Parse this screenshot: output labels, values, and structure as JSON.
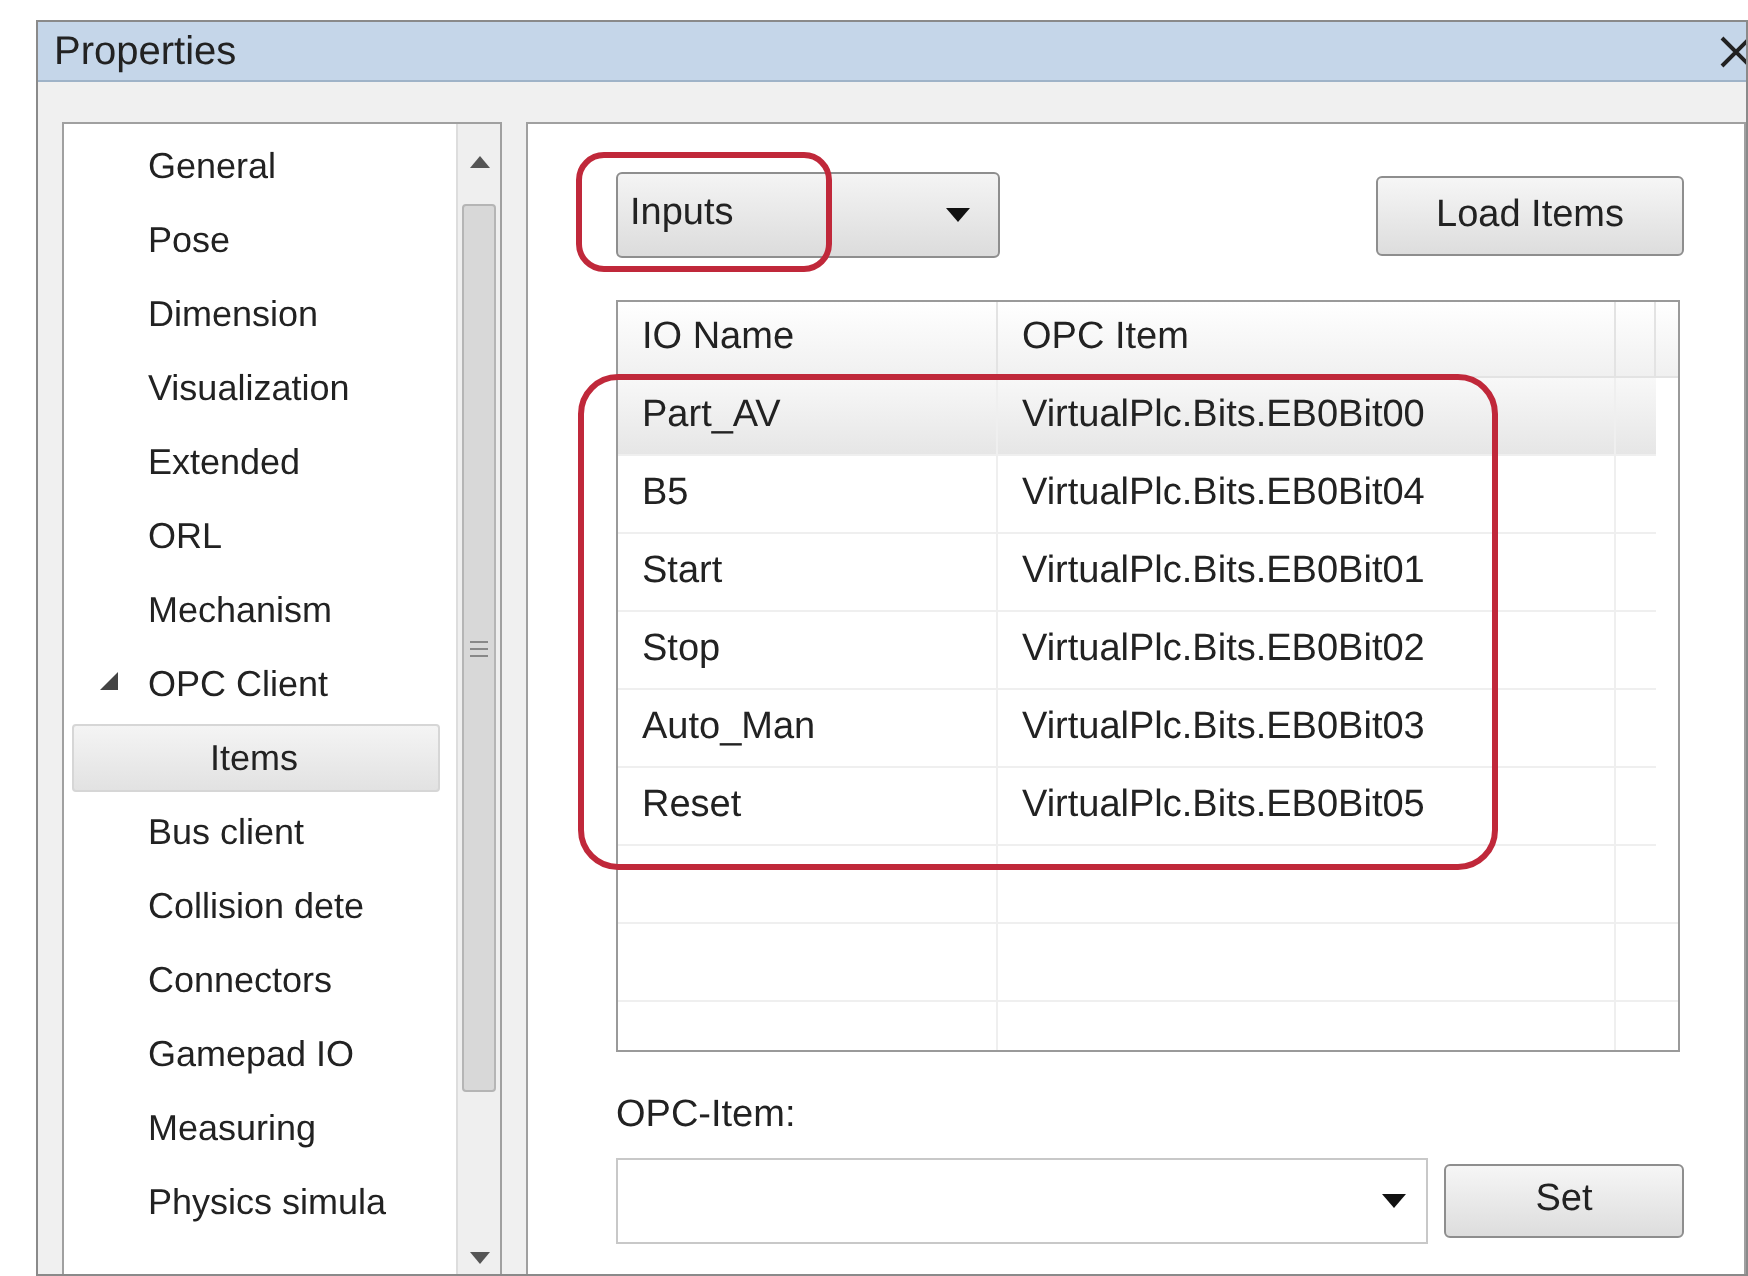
{
  "window": {
    "title": "Properties"
  },
  "sidebar": {
    "items": [
      {
        "label": "General",
        "selected": false
      },
      {
        "label": "Pose",
        "selected": false
      },
      {
        "label": "Dimension",
        "selected": false
      },
      {
        "label": "Visualization",
        "selected": false
      },
      {
        "label": "Extended",
        "selected": false
      },
      {
        "label": "ORL",
        "selected": false
      },
      {
        "label": "Mechanism",
        "selected": false
      },
      {
        "label": "OPC Client",
        "selected": false,
        "expanded": true,
        "children": [
          {
            "label": "Items",
            "selected": true
          }
        ]
      },
      {
        "label": "Bus client",
        "selected": false
      },
      {
        "label": "Collision dete",
        "selected": false
      },
      {
        "label": "Connectors",
        "selected": false
      },
      {
        "label": "Gamepad IO",
        "selected": false
      },
      {
        "label": "Measuring",
        "selected": false
      },
      {
        "label": "Physics simula",
        "selected": false
      }
    ]
  },
  "io_type": {
    "value": "Inputs",
    "highlighted": true
  },
  "load_button": "Load Items",
  "table": {
    "columns": [
      "IO Name",
      "OPC Item"
    ],
    "rows": [
      {
        "cells": [
          "Part_AV",
          "VirtualPlc.Bits.EB0Bit00"
        ],
        "selected": true
      },
      {
        "cells": [
          "B5",
          "VirtualPlc.Bits.EB0Bit04"
        ],
        "selected": false
      },
      {
        "cells": [
          "Start",
          "VirtualPlc.Bits.EB0Bit01"
        ],
        "selected": false
      },
      {
        "cells": [
          "Stop",
          "VirtualPlc.Bits.EB0Bit02"
        ],
        "selected": false
      },
      {
        "cells": [
          "Auto_Man",
          "VirtualPlc.Bits.EB0Bit03"
        ],
        "selected": false
      },
      {
        "cells": [
          "Reset",
          "VirtualPlc.Bits.EB0Bit05"
        ],
        "selected": false
      }
    ],
    "rows_highlighted": true
  },
  "opc_item": {
    "label": "OPC-Item:",
    "button": "Set"
  }
}
